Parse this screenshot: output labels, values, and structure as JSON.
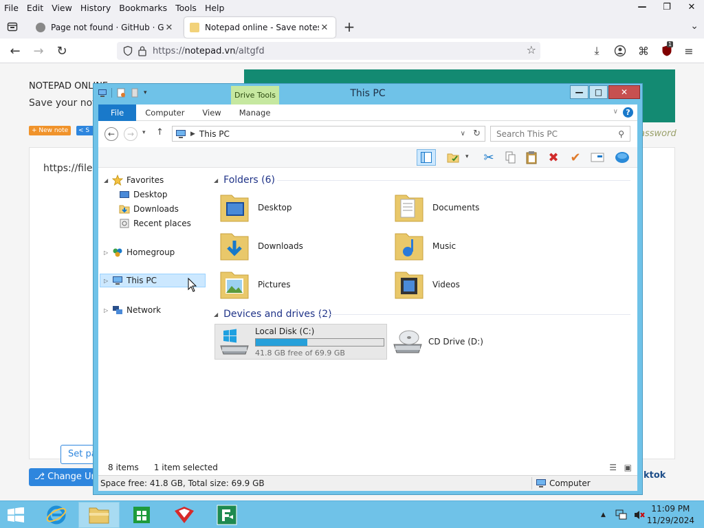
{
  "firefox": {
    "menu": [
      "File",
      "Edit",
      "View",
      "History",
      "Bookmarks",
      "Tools",
      "Help"
    ],
    "tabs": [
      {
        "title": "Page not found · GitHub · GitHub",
        "active": false
      },
      {
        "title": "Notepad online - Save notes online",
        "active": true
      }
    ],
    "url_prefix": "https://",
    "url_domain": "notepad.vn",
    "url_path": "/altgfd",
    "extension_badge": "1"
  },
  "notepad": {
    "title": "NOTEPAD ONLINE",
    "subtitle": "Save your notes",
    "new_note": "+ New note",
    "share": "< S",
    "password_hint": "assword",
    "editor_text": "https://files",
    "set_password": "Set pa",
    "change_url": "Change Url",
    "tiktok": "ktok"
  },
  "explorer": {
    "context_tab": "Drive Tools",
    "title": "This PC",
    "ribbon_tabs": [
      "File",
      "Computer",
      "View",
      "Manage"
    ],
    "address": "This PC",
    "search_placeholder": "Search This PC",
    "nav": {
      "favorites": "Favorites",
      "fav_items": [
        "Desktop",
        "Downloads",
        "Recent places"
      ],
      "homegroup": "Homegroup",
      "this_pc": "This PC",
      "network": "Network"
    },
    "folders_header": "Folders (6)",
    "folders": [
      "Desktop",
      "Documents",
      "Downloads",
      "Music",
      "Pictures",
      "Videos"
    ],
    "devices_header": "Devices and drives (2)",
    "drives": [
      {
        "name": "Local Disk (C:)",
        "free_text": "41.8 GB free of 69.9 GB",
        "used_fraction": 0.402
      },
      {
        "name": "CD Drive (D:)"
      }
    ],
    "status_items": "8 items",
    "status_selected": "1 item selected",
    "details_space": "Space free: 41.8 GB, Total size: 69.9 GB",
    "details_location": "Computer"
  },
  "taskbar": {
    "time": "11:09 PM",
    "date": "11/29/2024"
  },
  "colors": {
    "window_frame": "#6fc2e8",
    "file_tab": "#1979ca",
    "close_button": "#c75050",
    "drive_fill": "#26a0da",
    "banner": "#138a72"
  }
}
